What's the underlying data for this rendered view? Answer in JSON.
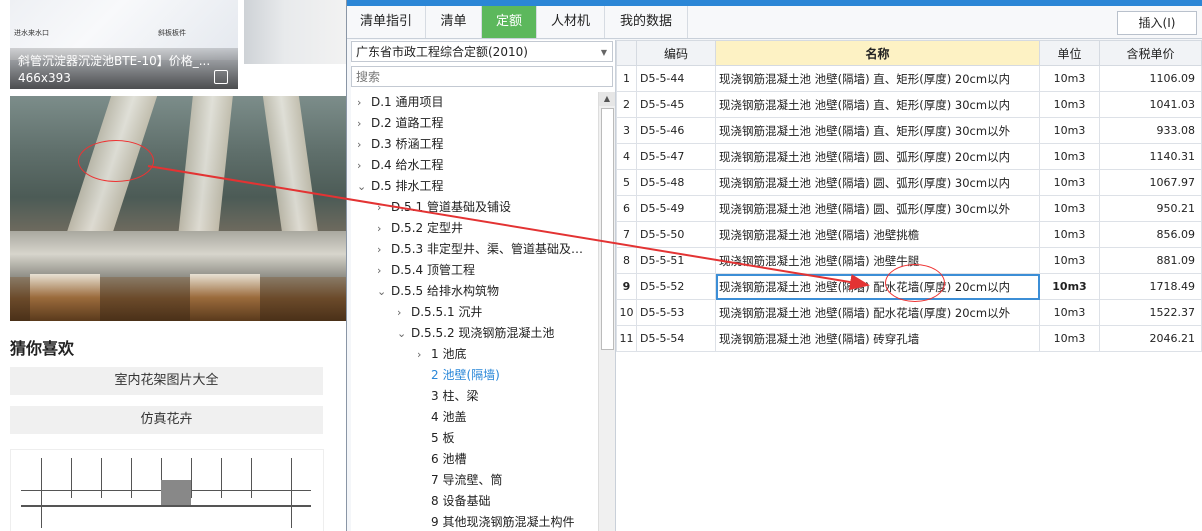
{
  "left_panel": {
    "image1_caption": "斜管沉淀器沉淀池BTE-10】价格_...",
    "image1_size": "466x393",
    "image1_tiny_left": "进水来水口",
    "image1_tiny_right": "斜板板件",
    "guess_title": "猜你喜欢",
    "suggestions": [
      "室内花架图片大全",
      "仿真花卉"
    ]
  },
  "app": {
    "tabs": [
      {
        "label": "清单指引",
        "active": false
      },
      {
        "label": "清单",
        "active": false
      },
      {
        "label": "定额",
        "active": true
      },
      {
        "label": "人材机",
        "active": false
      },
      {
        "label": "我的数据",
        "active": false
      }
    ],
    "insert_label": "插入(I)",
    "library_select": "广东省市政工程综合定额(2010)",
    "search_placeholder": "搜索",
    "tree": [
      {
        "label": "D.1 通用项目",
        "level": 0,
        "chev": ">"
      },
      {
        "label": "D.2 道路工程",
        "level": 0,
        "chev": ">"
      },
      {
        "label": "D.3 桥涵工程",
        "level": 0,
        "chev": ">"
      },
      {
        "label": "D.4 给水工程",
        "level": 0,
        "chev": ">"
      },
      {
        "label": "D.5 排水工程",
        "level": 0,
        "chev": "v"
      },
      {
        "label": "D.5.1 管道基础及铺设",
        "level": 1,
        "chev": ">"
      },
      {
        "label": "D.5.2 定型井",
        "level": 1,
        "chev": ">"
      },
      {
        "label": "D.5.3 非定型井、渠、管道基础及…",
        "level": 1,
        "chev": ">"
      },
      {
        "label": "D.5.4 顶管工程",
        "level": 1,
        "chev": ">"
      },
      {
        "label": "D.5.5 给排水构筑物",
        "level": 1,
        "chev": "v"
      },
      {
        "label": "D.5.5.1 沉井",
        "level": 2,
        "chev": ">"
      },
      {
        "label": "D.5.5.2 现浇钢筋混凝土池",
        "level": 2,
        "chev": "v"
      },
      {
        "label": "1 池底",
        "level": 3,
        "chev": ">"
      },
      {
        "label": "2 池壁(隔墙)",
        "level": 3,
        "chev": "",
        "selected": true
      },
      {
        "label": "3 柱、梁",
        "level": 3,
        "chev": ""
      },
      {
        "label": "4 池盖",
        "level": 3,
        "chev": ""
      },
      {
        "label": "5 板",
        "level": 3,
        "chev": ""
      },
      {
        "label": "6 池槽",
        "level": 3,
        "chev": ""
      },
      {
        "label": "7 导流壁、筒",
        "level": 3,
        "chev": ""
      },
      {
        "label": "8 设备基础",
        "level": 3,
        "chev": ""
      },
      {
        "label": "9 其他现浇钢筋混凝土构件",
        "level": 3,
        "chev": ""
      }
    ],
    "grid_headers": [
      "",
      "编码",
      "名称",
      "单位",
      "含税单价"
    ],
    "rows": [
      {
        "no": "1",
        "code": "D5-5-44",
        "name": "现浇钢筋混凝土池 池壁(隔墙) 直、矩形(厚度) 20cm以内",
        "unit": "10m3",
        "price": "1106.09"
      },
      {
        "no": "2",
        "code": "D5-5-45",
        "name": "现浇钢筋混凝土池 池壁(隔墙) 直、矩形(厚度) 30cm以内",
        "unit": "10m3",
        "price": "1041.03"
      },
      {
        "no": "3",
        "code": "D5-5-46",
        "name": "现浇钢筋混凝土池 池壁(隔墙) 直、矩形(厚度) 30cm以外",
        "unit": "10m3",
        "price": "933.08"
      },
      {
        "no": "4",
        "code": "D5-5-47",
        "name": "现浇钢筋混凝土池 池壁(隔墙) 圆、弧形(厚度) 20cm以内",
        "unit": "10m3",
        "price": "1140.31"
      },
      {
        "no": "5",
        "code": "D5-5-48",
        "name": "现浇钢筋混凝土池 池壁(隔墙) 圆、弧形(厚度) 30cm以内",
        "unit": "10m3",
        "price": "1067.97"
      },
      {
        "no": "6",
        "code": "D5-5-49",
        "name": "现浇钢筋混凝土池 池壁(隔墙) 圆、弧形(厚度) 30cm以外",
        "unit": "10m3",
        "price": "950.21"
      },
      {
        "no": "7",
        "code": "D5-5-50",
        "name": "现浇钢筋混凝土池 池壁(隔墙) 池壁挑檐",
        "unit": "10m3",
        "price": "856.09"
      },
      {
        "no": "8",
        "code": "D5-5-51",
        "name": "现浇钢筋混凝土池 池壁(隔墙) 池壁牛腿",
        "unit": "10m3",
        "price": "881.09"
      },
      {
        "no": "9",
        "code": "D5-5-52",
        "name": "现浇钢筋混凝土池 池壁(隔墙) 配水花墙(厚度) 20cm以内",
        "unit": "10m3",
        "price": "1718.49",
        "selected": true
      },
      {
        "no": "10",
        "code": "D5-5-53",
        "name": "现浇钢筋混凝土池 池壁(隔墙) 配水花墙(厚度) 20cm以外",
        "unit": "10m3",
        "price": "1522.37"
      },
      {
        "no": "11",
        "code": "D5-5-54",
        "name": "现浇钢筋混凝土池 池壁(隔墙) 砖穿孔墙",
        "unit": "10m3",
        "price": "2046.21"
      }
    ]
  },
  "colors": {
    "accent": "#2b86d6",
    "active_tab": "#5cb85c",
    "annotation": "#e33333",
    "name_header": "#fdf2c4"
  }
}
